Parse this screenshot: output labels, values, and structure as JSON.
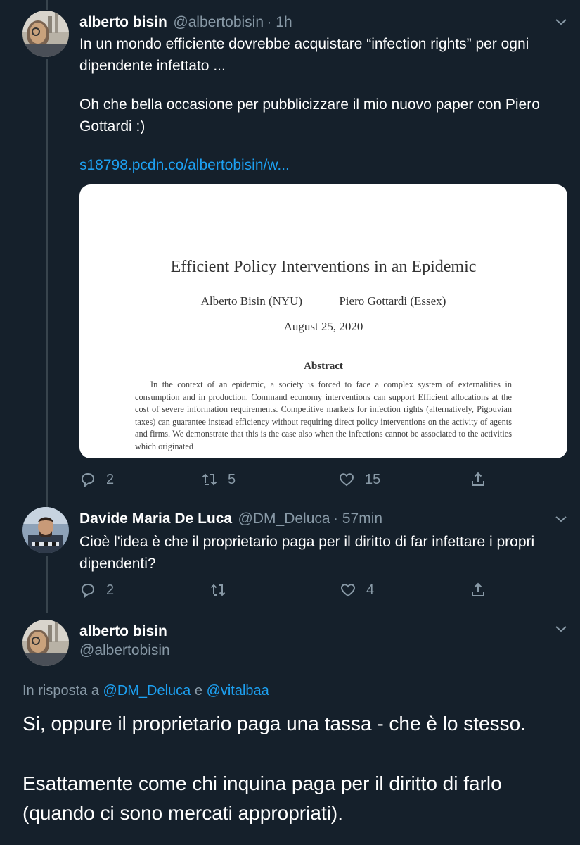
{
  "tweet1": {
    "name": "alberto bisin",
    "handle": "@albertobisin",
    "time": "· 1h",
    "line1": "In un mondo efficiente dovrebbe acquistare “infection rights” per ogni",
    "line2": "dipendente infettato ...",
    "line3": "Oh che bella occasione per pubblicizzare il mio nuovo paper con Piero",
    "line4": "Gottardi :)",
    "link": "s18798.pcdn.co/albertobisin/w...",
    "card": {
      "title": "Efficient Policy Interventions in an Epidemic",
      "author1": "Alberto Bisin (NYU)",
      "author2": "Piero Gottardi (Essex)",
      "date": "August 25, 2020",
      "abstract_heading": "Abstract",
      "abstract_text": "In the context of an epidemic, a society is forced to face a complex system of externalities in consumption and in production. Command economy interventions can support Efficient allocations at the cost of severe information requirements. Competitive markets for infection rights (alternatively, Pigouvian taxes) can guarantee instead efficiency without requiring direct policy interventions on the activity of agents and firms. We demonstrate that this is the case also when the infections cannot be associated to the activities which originated"
    },
    "replies": "2",
    "retweets": "5",
    "likes": "15"
  },
  "tweet2": {
    "name": "Davide Maria De Luca",
    "handle": "@DM_Deluca",
    "time": "· 57min",
    "line1": "Cioè l'idea è che il proprietario paga per il diritto di far infettare i propri",
    "line2": "dipendenti?",
    "replies": "2",
    "retweets": "",
    "likes": "4"
  },
  "tweet3": {
    "name": "alberto bisin",
    "handle": "@albertobisin",
    "reply_prefix": "In risposta a",
    "reply_user1": "@DM_Deluca",
    "reply_and": "e",
    "reply_user2": "@vitalbaa",
    "line1": "Si, oppure il proprietario paga una tassa - che è lo stesso.",
    "line2": "Esattamente come chi inquina paga per il diritto di farlo",
    "line3": "(quando ci sono mercati appropriati)."
  },
  "colors": {
    "background": "#15202b",
    "secondary_text": "#8899a6",
    "link": "#1da1f2"
  },
  "icons": [
    "reply-icon",
    "retweet-icon",
    "like-icon",
    "share-icon",
    "chevron-down-icon"
  ]
}
